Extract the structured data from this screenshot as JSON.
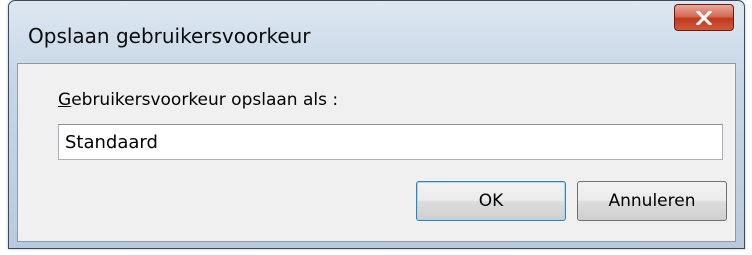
{
  "dialog": {
    "title": "Opslaan gebruikersvoorkeur",
    "close_icon": "close-icon"
  },
  "form": {
    "label_accesskey": "G",
    "label_rest": "ebruikersvoorkeur opslaan als :",
    "name_value": "Standaard"
  },
  "buttons": {
    "ok_label": "OK",
    "cancel_label": "Annuleren"
  },
  "colors": {
    "close_button": "#c0391b",
    "ok_focus_border": "#3c7fb1",
    "dialog_body": "#f0f0f0"
  }
}
